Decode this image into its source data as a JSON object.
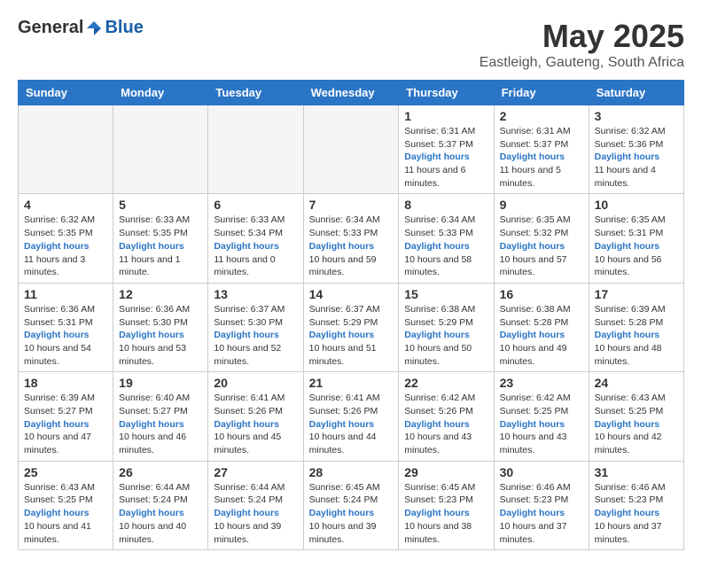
{
  "logo": {
    "general": "General",
    "blue": "Blue"
  },
  "header": {
    "title": "May 2025",
    "subtitle": "Eastleigh, Gauteng, South Africa"
  },
  "weekdays": [
    "Sunday",
    "Monday",
    "Tuesday",
    "Wednesday",
    "Thursday",
    "Friday",
    "Saturday"
  ],
  "weeks": [
    [
      {
        "day": "",
        "info": ""
      },
      {
        "day": "",
        "info": ""
      },
      {
        "day": "",
        "info": ""
      },
      {
        "day": "",
        "info": ""
      },
      {
        "day": "1",
        "sunrise": "6:31 AM",
        "sunset": "5:37 PM",
        "daylight": "11 hours and 6 minutes."
      },
      {
        "day": "2",
        "sunrise": "6:31 AM",
        "sunset": "5:37 PM",
        "daylight": "11 hours and 5 minutes."
      },
      {
        "day": "3",
        "sunrise": "6:32 AM",
        "sunset": "5:36 PM",
        "daylight": "11 hours and 4 minutes."
      }
    ],
    [
      {
        "day": "4",
        "sunrise": "6:32 AM",
        "sunset": "5:35 PM",
        "daylight": "11 hours and 3 minutes."
      },
      {
        "day": "5",
        "sunrise": "6:33 AM",
        "sunset": "5:35 PM",
        "daylight": "11 hours and 1 minute."
      },
      {
        "day": "6",
        "sunrise": "6:33 AM",
        "sunset": "5:34 PM",
        "daylight": "11 hours and 0 minutes."
      },
      {
        "day": "7",
        "sunrise": "6:34 AM",
        "sunset": "5:33 PM",
        "daylight": "10 hours and 59 minutes."
      },
      {
        "day": "8",
        "sunrise": "6:34 AM",
        "sunset": "5:33 PM",
        "daylight": "10 hours and 58 minutes."
      },
      {
        "day": "9",
        "sunrise": "6:35 AM",
        "sunset": "5:32 PM",
        "daylight": "10 hours and 57 minutes."
      },
      {
        "day": "10",
        "sunrise": "6:35 AM",
        "sunset": "5:31 PM",
        "daylight": "10 hours and 56 minutes."
      }
    ],
    [
      {
        "day": "11",
        "sunrise": "6:36 AM",
        "sunset": "5:31 PM",
        "daylight": "10 hours and 54 minutes."
      },
      {
        "day": "12",
        "sunrise": "6:36 AM",
        "sunset": "5:30 PM",
        "daylight": "10 hours and 53 minutes."
      },
      {
        "day": "13",
        "sunrise": "6:37 AM",
        "sunset": "5:30 PM",
        "daylight": "10 hours and 52 minutes."
      },
      {
        "day": "14",
        "sunrise": "6:37 AM",
        "sunset": "5:29 PM",
        "daylight": "10 hours and 51 minutes."
      },
      {
        "day": "15",
        "sunrise": "6:38 AM",
        "sunset": "5:29 PM",
        "daylight": "10 hours and 50 minutes."
      },
      {
        "day": "16",
        "sunrise": "6:38 AM",
        "sunset": "5:28 PM",
        "daylight": "10 hours and 49 minutes."
      },
      {
        "day": "17",
        "sunrise": "6:39 AM",
        "sunset": "5:28 PM",
        "daylight": "10 hours and 48 minutes."
      }
    ],
    [
      {
        "day": "18",
        "sunrise": "6:39 AM",
        "sunset": "5:27 PM",
        "daylight": "10 hours and 47 minutes."
      },
      {
        "day": "19",
        "sunrise": "6:40 AM",
        "sunset": "5:27 PM",
        "daylight": "10 hours and 46 minutes."
      },
      {
        "day": "20",
        "sunrise": "6:41 AM",
        "sunset": "5:26 PM",
        "daylight": "10 hours and 45 minutes."
      },
      {
        "day": "21",
        "sunrise": "6:41 AM",
        "sunset": "5:26 PM",
        "daylight": "10 hours and 44 minutes."
      },
      {
        "day": "22",
        "sunrise": "6:42 AM",
        "sunset": "5:26 PM",
        "daylight": "10 hours and 43 minutes."
      },
      {
        "day": "23",
        "sunrise": "6:42 AM",
        "sunset": "5:25 PM",
        "daylight": "10 hours and 43 minutes."
      },
      {
        "day": "24",
        "sunrise": "6:43 AM",
        "sunset": "5:25 PM",
        "daylight": "10 hours and 42 minutes."
      }
    ],
    [
      {
        "day": "25",
        "sunrise": "6:43 AM",
        "sunset": "5:25 PM",
        "daylight": "10 hours and 41 minutes."
      },
      {
        "day": "26",
        "sunrise": "6:44 AM",
        "sunset": "5:24 PM",
        "daylight": "10 hours and 40 minutes."
      },
      {
        "day": "27",
        "sunrise": "6:44 AM",
        "sunset": "5:24 PM",
        "daylight": "10 hours and 39 minutes."
      },
      {
        "day": "28",
        "sunrise": "6:45 AM",
        "sunset": "5:24 PM",
        "daylight": "10 hours and 39 minutes."
      },
      {
        "day": "29",
        "sunrise": "6:45 AM",
        "sunset": "5:23 PM",
        "daylight": "10 hours and 38 minutes."
      },
      {
        "day": "30",
        "sunrise": "6:46 AM",
        "sunset": "5:23 PM",
        "daylight": "10 hours and 37 minutes."
      },
      {
        "day": "31",
        "sunrise": "6:46 AM",
        "sunset": "5:23 PM",
        "daylight": "10 hours and 37 minutes."
      }
    ]
  ],
  "labels": {
    "sunrise": "Sunrise: ",
    "sunset": "Sunset: ",
    "daylight": "Daylight hours"
  }
}
